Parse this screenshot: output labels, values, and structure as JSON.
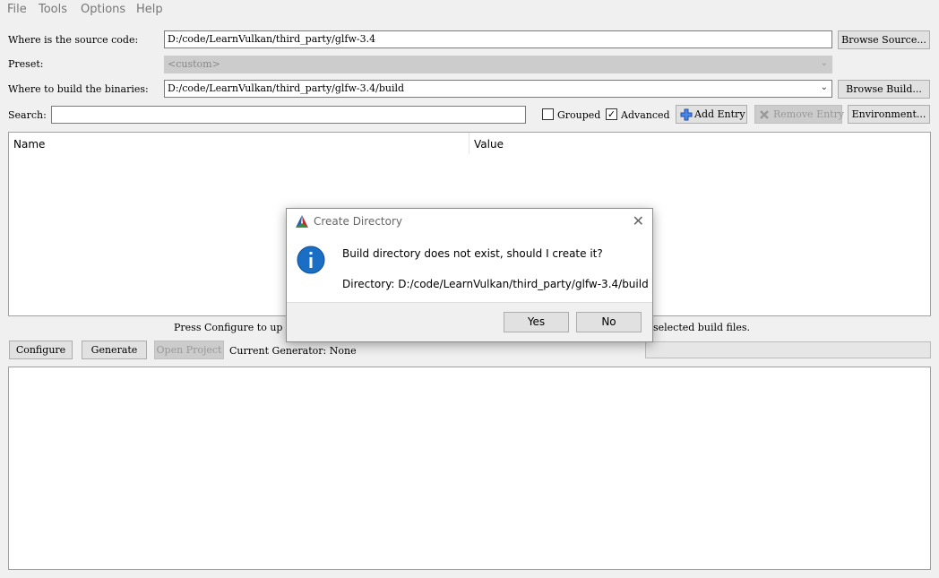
{
  "menubar": {
    "items": [
      "File",
      "Tools",
      "Options",
      "Help"
    ]
  },
  "source": {
    "label": "Where is the source code:",
    "value": "D:/code/LearnVulkan/third_party/glfw-3.4",
    "browse_label": "Browse Source..."
  },
  "preset": {
    "label": "Preset:",
    "value": "<custom>"
  },
  "build": {
    "label": "Where to build the binaries:",
    "value": "D:/code/LearnVulkan/third_party/glfw-3.4/build",
    "browse_label": "Browse Build..."
  },
  "search": {
    "label": "Search:",
    "value": "",
    "placeholder": ""
  },
  "options": {
    "grouped_label": "Grouped",
    "grouped_checked": false,
    "advanced_label": "Advanced",
    "advanced_checked": true,
    "add_entry_label": "Add Entry",
    "remove_entry_label": "Remove Entry",
    "environment_label": "Environment..."
  },
  "table": {
    "columns": [
      "Name",
      "Value"
    ]
  },
  "status": {
    "left": "Press Configure to up",
    "right": "selected build files."
  },
  "actions": {
    "configure_label": "Configure",
    "generate_label": "Generate",
    "open_project_label": "Open Project",
    "current_generator": "Current Generator: None"
  },
  "dialog": {
    "title": "Create Directory",
    "message": "Build directory does not exist, should I create it?",
    "directory": "Directory: D:/code/LearnVulkan/third_party/glfw-3.4/build",
    "yes_label": "Yes",
    "no_label": "No"
  },
  "colors": {
    "info_blue": "#1a6fc4",
    "add_blue": "#1e5fd0",
    "cmake_red": "#c4282e",
    "cmake_green": "#3b8a3e",
    "cmake_blue": "#2c5fa8"
  }
}
